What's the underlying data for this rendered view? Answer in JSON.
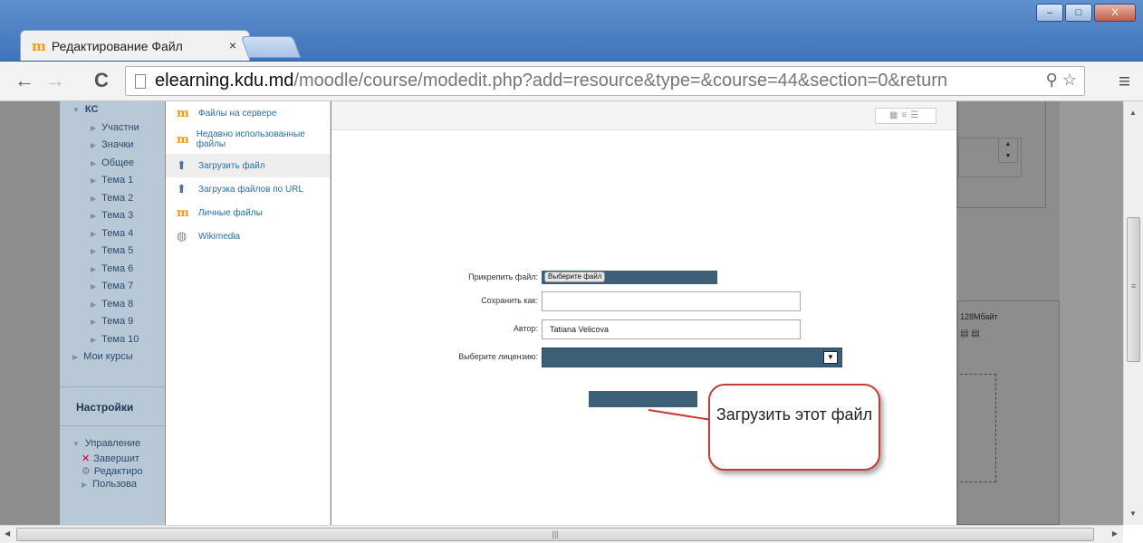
{
  "browser": {
    "tab_title": "Редактирование Файл",
    "tab_close": "×",
    "url_host": "elearning.kdu.md",
    "url_path": "/moodle/course/modedit.php?add=resource&type=&course=44&section=0&return",
    "window_buttons": [
      "–",
      "□",
      "X"
    ]
  },
  "course_nav": {
    "root": "КС",
    "items": [
      "Участни",
      "Значки",
      "Общее",
      "Тема 1",
      "Тема 2",
      "Тема 3",
      "Тема 4",
      "Тема 5",
      "Тема 6",
      "Тема 7",
      "Тема 8",
      "Тема 9",
      "Тема 10"
    ],
    "my_courses": "Мои курсы",
    "settings_title": "Настройки",
    "admin": [
      "Управление",
      "Завершит",
      "Редактиро",
      "Пользова"
    ]
  },
  "file_picker": {
    "repos": [
      {
        "label": "Файлы на сервере",
        "icon": "moodle-icon"
      },
      {
        "label": "Недавно использованные файлы",
        "icon": "moodle-icon"
      },
      {
        "label": "Загрузить файл",
        "icon": "upload-icon"
      },
      {
        "label": "Загрузка файлов по URL",
        "icon": "url-download-icon"
      },
      {
        "label": "Личные файлы",
        "icon": "moodle-icon"
      },
      {
        "label": "Wikimedia",
        "icon": "wikimedia-icon"
      }
    ],
    "attach_label": "Прикрепить файл:",
    "choose_file_button": "Выберите файл",
    "file_chosen_text": "",
    "save_as_label": "Сохранить как:",
    "save_as_value": "",
    "author_label": "Автор:",
    "author_value": "Tatiana Velicova",
    "license_label": "Выберите лицензию:",
    "license_value": "",
    "upload_button": ""
  },
  "right_panel": {
    "max_size": "128Мбайт"
  },
  "callout": {
    "text": "Загрузить этот файл"
  }
}
